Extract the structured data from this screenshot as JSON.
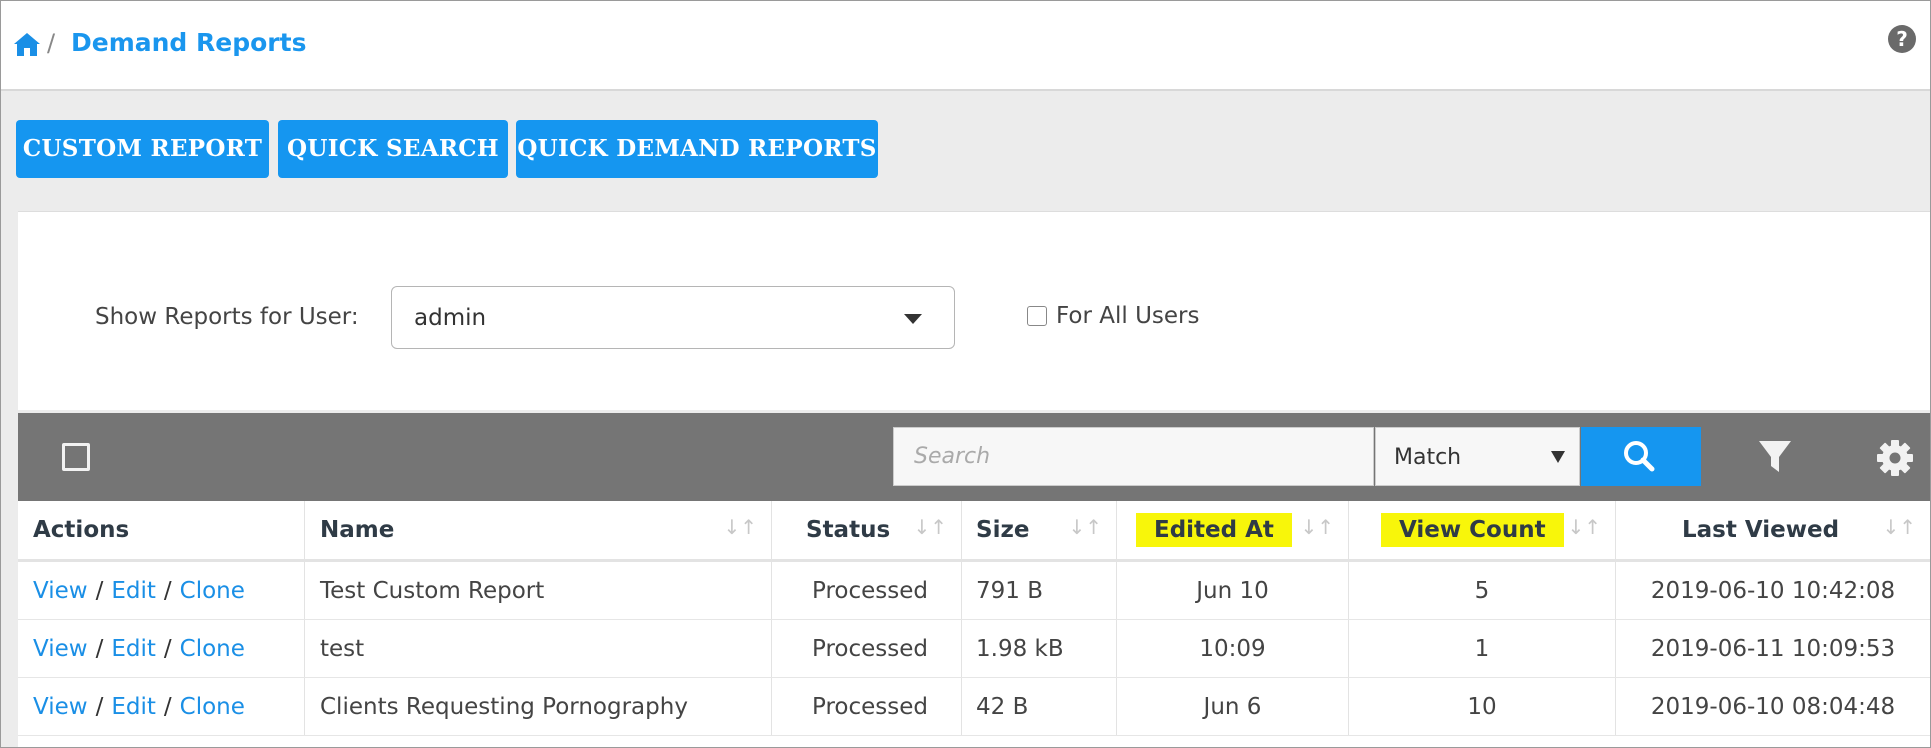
{
  "header": {
    "home_icon": "home-icon",
    "breadcrumb_separator": "/",
    "title": "Demand Reports",
    "help_icon": "question-circle-icon"
  },
  "tabs": [
    {
      "label": "CUSTOM REPORT"
    },
    {
      "label": "QUICK SEARCH"
    },
    {
      "label": "QUICK DEMAND REPORTS"
    }
  ],
  "filter": {
    "label": "Show Reports for User:",
    "user_value": "admin",
    "all_users_label": "For All Users",
    "all_users_checked": false
  },
  "toolbar": {
    "search_placeholder": "Search",
    "match_value": "Match",
    "search_button_icon": "search-icon",
    "filter_icon": "filter-icon",
    "settings_icon": "gear-icon"
  },
  "table": {
    "columns": [
      "Actions",
      "Name",
      "Status",
      "Size",
      "Edited At",
      "View Count",
      "Last Viewed"
    ],
    "highlighted_columns": [
      "Edited At",
      "View Count"
    ],
    "actions": [
      "View",
      "Edit",
      "Clone"
    ],
    "rows": [
      {
        "name": "Test Custom Report",
        "status": "Processed",
        "size": "791 B",
        "edited_at": "Jun 10",
        "view_count": "5",
        "last_viewed": "2019-06-10 10:42:08"
      },
      {
        "name": "test",
        "status": "Processed",
        "size": "1.98 kB",
        "edited_at": "10:09",
        "view_count": "1",
        "last_viewed": "2019-06-11 10:09:53"
      },
      {
        "name": "Clients Requesting Pornography",
        "status": "Processed",
        "size": "42 B",
        "edited_at": "Jun 6",
        "view_count": "10",
        "last_viewed": "2019-06-10 08:04:48"
      }
    ]
  },
  "colors": {
    "accent": "#1596f0",
    "toolbar": "#757575",
    "highlight": "#f8f60a"
  }
}
